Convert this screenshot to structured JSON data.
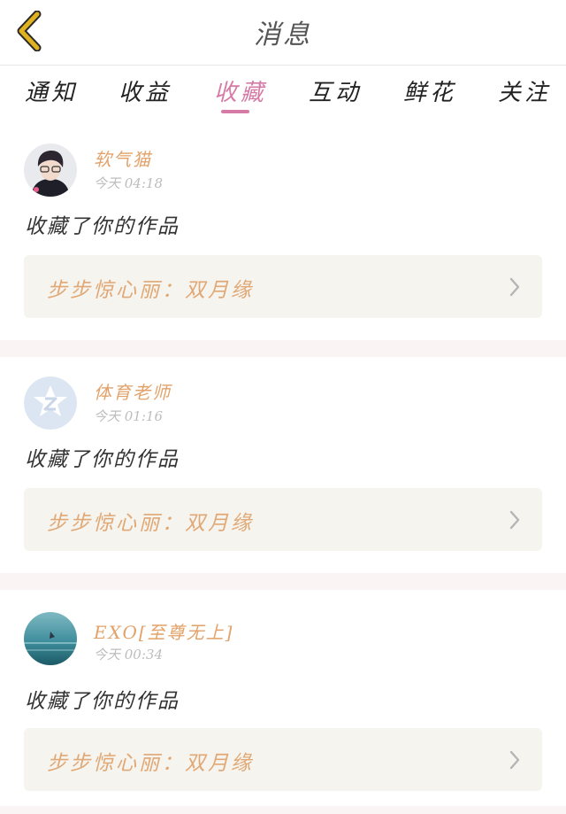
{
  "header": {
    "title": "消息",
    "back_icon": "chevron-left-icon",
    "accent": "#e0b21f"
  },
  "tabs": [
    {
      "label": "通知",
      "active": false
    },
    {
      "label": "收益",
      "active": false
    },
    {
      "label": "收藏",
      "active": true
    },
    {
      "label": "互动",
      "active": false
    },
    {
      "label": "鲜花",
      "active": false
    },
    {
      "label": "关注",
      "active": false
    }
  ],
  "colors": {
    "tab_active": "#d67aa6",
    "username": "#e2a26a",
    "work_title": "#e0a876",
    "work_bg": "#f6f4ee",
    "separator": "#fbf4f4"
  },
  "notifications": [
    {
      "username": "软气猫",
      "time": "今天 04:18",
      "action": "收藏了你的作品",
      "work_title": "步步惊心丽：双月缘",
      "avatar": "person-photo"
    },
    {
      "username": "体育老师",
      "time": "今天 01:16",
      "action": "收藏了你的作品",
      "work_title": "步步惊心丽：双月缘",
      "avatar": "default-star-avatar"
    },
    {
      "username": "EXO[至尊无上]",
      "time": "今天 00:34",
      "action": "收藏了你的作品",
      "work_title": "步步惊心丽：双月缘",
      "avatar": "ocean-photo"
    }
  ]
}
